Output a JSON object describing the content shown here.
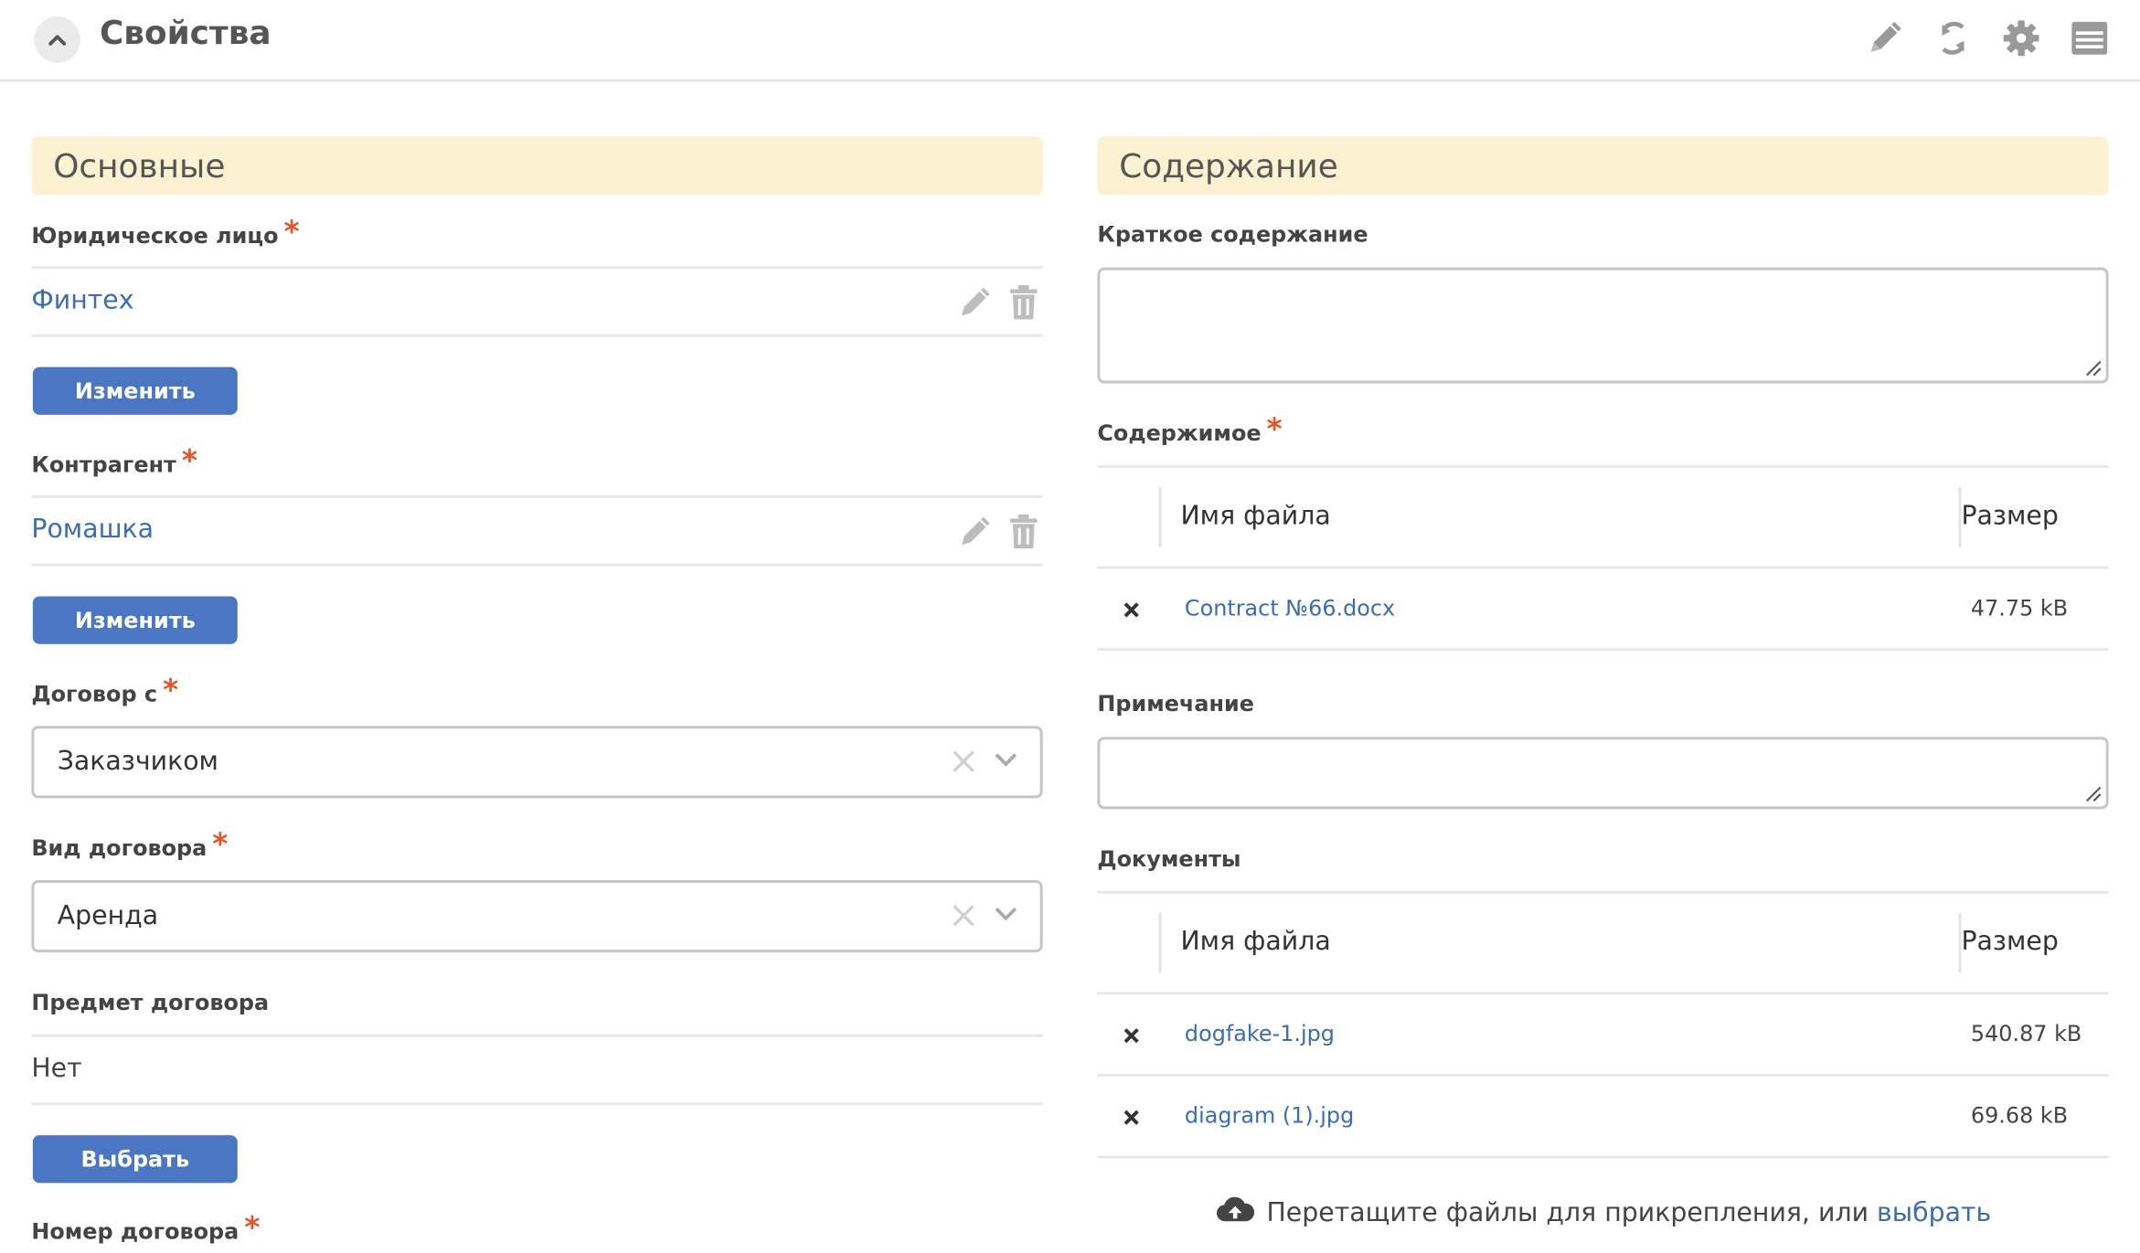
{
  "header": {
    "title": "Свойства",
    "icons": [
      "chevron-up-icon",
      "pencil-icon",
      "refresh-icon",
      "gear-icon",
      "menu-icon"
    ]
  },
  "left": {
    "section_title": "Основные",
    "legal_entity": {
      "label": "Юридическое лицо",
      "required_mark": "*",
      "value": "Финтех",
      "button": "Изменить"
    },
    "counterparty": {
      "label": "Контрагент",
      "required_mark": "*",
      "value": "Ромашка",
      "button": "Изменить"
    },
    "contract_with": {
      "label": "Договор с",
      "required_mark": "*",
      "value": "Заказчиком"
    },
    "contract_type": {
      "label": "Вид договора",
      "required_mark": "*",
      "value": "Аренда"
    },
    "contract_subject": {
      "label": "Предмет договора",
      "value": "Нет",
      "button": "Выбрать"
    },
    "contract_number": {
      "label": "Номер договора",
      "required_mark": "*"
    }
  },
  "right": {
    "section_title": "Содержание",
    "summary": {
      "label": "Краткое содержание",
      "value": ""
    },
    "contents": {
      "label": "Содержимое",
      "required_mark": "*",
      "columns": [
        "Имя файла",
        "Размер"
      ],
      "rows": [
        {
          "name": "Contract №66.docx",
          "size": "47.75 kB"
        }
      ]
    },
    "note": {
      "label": "Примечание",
      "value": ""
    },
    "documents": {
      "label": "Документы",
      "columns": [
        "Имя файла",
        "Размер"
      ],
      "rows": [
        {
          "name": "dogfake-1.jpg",
          "size": "540.87 kB"
        },
        {
          "name": "diagram (1).jpg",
          "size": "69.68 kB"
        }
      ]
    },
    "dropzone": {
      "text": "Перетащите файлы для прикрепления, или ",
      "link": "выбрать"
    }
  },
  "colors": {
    "accent": "#4a76c4",
    "link": "#3a6db5",
    "section_bg": "#fcf2d2",
    "required": "#e5542a"
  }
}
